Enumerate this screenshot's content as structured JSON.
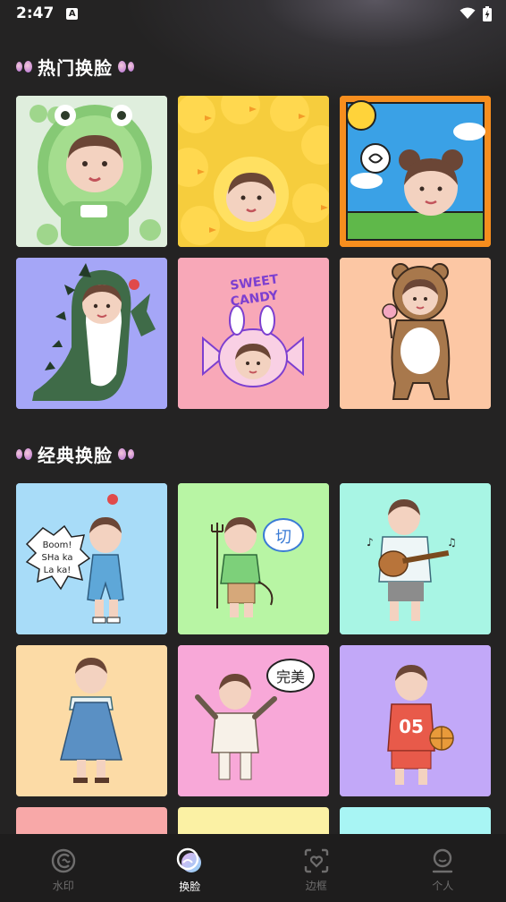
{
  "status_bar": {
    "time": "2:47",
    "notification_icon": "a-icon",
    "wifi_icon": "wifi-icon",
    "battery_icon": "battery-charging-icon"
  },
  "sections": [
    {
      "title": "热门换脸",
      "cards": [
        {
          "name": "green-frog-costume",
          "bg": "#dfeedd"
        },
        {
          "name": "yellow-ducks",
          "bg": "#f6cd3d"
        },
        {
          "name": "sun-cartoon-frame",
          "bg": "#f78e1e"
        },
        {
          "name": "green-dinosaur",
          "bg": "#a5a6f7"
        },
        {
          "name": "sweet-candy-bunny",
          "bg": "#f8a8b8"
        },
        {
          "name": "bear-costume",
          "bg": "#fcc7a4"
        }
      ]
    },
    {
      "title": "经典换脸",
      "cards": [
        {
          "name": "boom-shakalaka",
          "bg": "#a8dcf8"
        },
        {
          "name": "devil-fork",
          "bg": "#b8f5a4"
        },
        {
          "name": "guitar-player",
          "bg": "#a8f5e4"
        },
        {
          "name": "blue-overalls",
          "bg": "#fcdba6"
        },
        {
          "name": "wanmei-perfect",
          "bg": "#f8a8d8"
        },
        {
          "name": "basketball-05",
          "bg": "#c2a8f8"
        }
      ]
    }
  ],
  "card_texts": {
    "sweet_candy_line1": "SWEET",
    "sweet_candy_line2": "CANDY",
    "boom_line1": "Boom!",
    "boom_line2": "SHa ka",
    "boom_line3": "La ka!",
    "qie_bubble": "切",
    "wanmei_bubble": "完美",
    "jersey_number": "05"
  },
  "partial_row_colors": [
    "#f8a8a8",
    "#fbf1a4",
    "#a8f5f4"
  ],
  "tab_bar": {
    "tabs": [
      {
        "label": "水印",
        "icon": "watermark-icon",
        "active": false
      },
      {
        "label": "换脸",
        "icon": "faceswap-icon",
        "active": true
      },
      {
        "label": "边框",
        "icon": "frame-heart-icon",
        "active": false
      },
      {
        "label": "个人",
        "icon": "person-icon",
        "active": false
      }
    ]
  },
  "colors": {
    "background": "#242323",
    "tab_bar_bg": "#1e1d1d",
    "tab_inactive": "#6e6d6d",
    "tab_active": "#ffffff"
  }
}
